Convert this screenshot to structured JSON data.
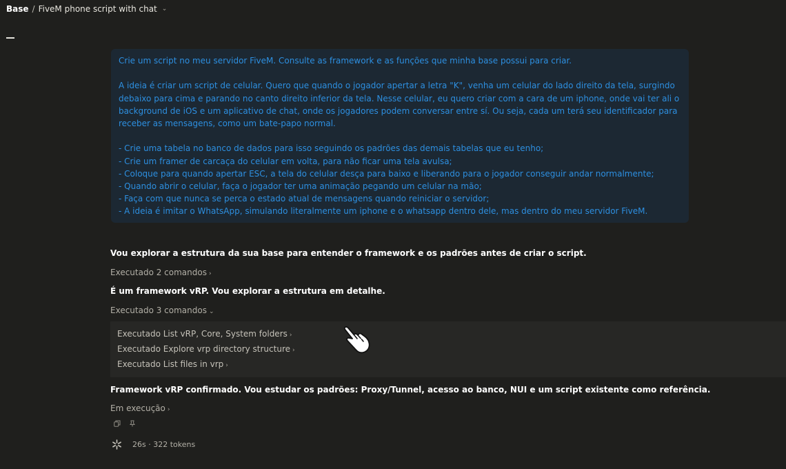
{
  "breadcrumb": {
    "root": "Base",
    "separator": "/",
    "title": "FiveM phone script with chat",
    "chevron_icon": "chevron-down-icon"
  },
  "user_message": {
    "paragraph1": "Crie um script no meu servidor FiveM. Consulte as framework e as funções que minha base possui para criar.",
    "paragraph2": [
      "A ideia é criar um script de celular. Quero que quando o jogador apertar a letra \"K\", venha um celular do lado direito da tela, surgindo",
      "debaixo para cima e parando no canto direito inferior da tela. Nesse celular, eu quero criar com a cara de um iphone, onde vai ter ali o",
      "background de iOS e um aplicativo de chat, onde os jogadores podem conversar entre sí. Ou seja, cada um terá seu identificador para",
      "receber as mensagens, como um bate-papo normal."
    ],
    "bullets": [
      "- Crie uma tabela no banco de dados para isso seguindo os padrões das demais tabelas que eu tenho;",
      "- Crie um framer de carcaça do celular em volta, para não ficar uma tela avulsa;",
      "- Coloque para quando apertar ESC, a tela do celular desça para baixo e liberando para o jogador conseguir andar normalmente;",
      "- Quando abrir o celular, faça o jogador ter uma animação pegando um celular na mão;",
      "- Faça com que nunca se perca o estado atual de mensagens quando reiniciar o servidor;",
      "- A ideia é imitar o WhatsApp, simulando literalmente um iphone e o whatsapp dentro dele, mas dentro do meu servidor FiveM."
    ]
  },
  "assistant": {
    "msg1": "Vou explorar a estrutura da sua base para entender o framework e os padrões antes de criar o script.",
    "toggle1": "Executado 2 comandos",
    "msg2": "É um framework vRP. Vou explorar a estrutura em detalhe.",
    "toggle2": "Executado 3 comandos",
    "commands": [
      "Executado List vRP, Core, System folders",
      "Executado Explore vrp directory structure",
      "Executado List files in vrp"
    ],
    "msg3": "Framework vRP confirmado. Vou estudar os padrões: Proxy/Tunnel, acesso ao banco, NUI e um script existente como referência.",
    "toggle3": "Em execução"
  },
  "status": {
    "text": "26s · 322 tokens",
    "icon": "asterisk-spinner-icon"
  },
  "icons": {
    "menu": "menu-icon",
    "copy": "copy-icon",
    "pin": "pin-icon",
    "cursor": "hand-pointer-icon",
    "chevron_right": "chevron-right-icon",
    "chevron_down": "chevron-down-icon"
  },
  "colors": {
    "background": "#1f1f1d",
    "user_bubble": "#1c2833",
    "user_text": "#2d8fe0",
    "command_box": "#272725"
  }
}
